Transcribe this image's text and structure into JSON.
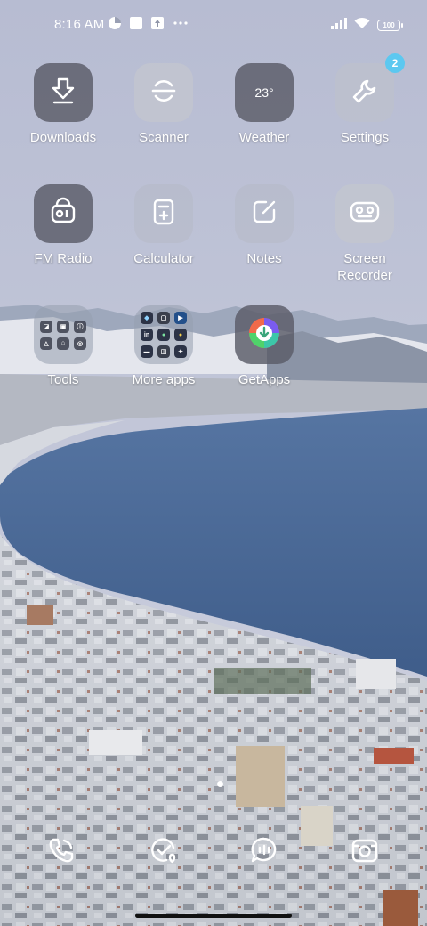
{
  "status_bar": {
    "time": "8:16 AM",
    "left_icons": [
      "data-saver-icon",
      "notification-square-icon",
      "upload-icon",
      "more-dots-icon"
    ],
    "right_icons": [
      "signal-icon",
      "wifi-icon",
      "battery-icon"
    ],
    "battery_level": "100"
  },
  "apps": [
    {
      "label": "Downloads",
      "icon": "download-icon"
    },
    {
      "label": "Scanner",
      "icon": "scanner-icon"
    },
    {
      "label": "Weather",
      "icon": "weather-icon",
      "temp": "23°"
    },
    {
      "label": "Settings",
      "icon": "wrench-icon",
      "badge": "2"
    },
    {
      "label": "FM Radio",
      "icon": "radio-icon"
    },
    {
      "label": "Calculator",
      "icon": "calculator-icon"
    },
    {
      "label": "Notes",
      "icon": "notes-icon"
    },
    {
      "label": "Screen Recorder",
      "icon": "screen-recorder-icon"
    },
    {
      "label": "Tools",
      "icon": "folder-icon"
    },
    {
      "label": "More apps",
      "icon": "folder-icon"
    },
    {
      "label": "GetApps",
      "icon": "getapps-icon"
    }
  ],
  "more_apps_folder": {
    "linkedin_text": "in"
  },
  "dock": [
    "phone-icon",
    "security-icon",
    "messages-icon",
    "camera-icon"
  ],
  "colors": {
    "badge": "#5cc8f0",
    "tile_dark": "#5a5c68",
    "tile_light": "#c4c6ce",
    "sea": "#4a6a96"
  }
}
